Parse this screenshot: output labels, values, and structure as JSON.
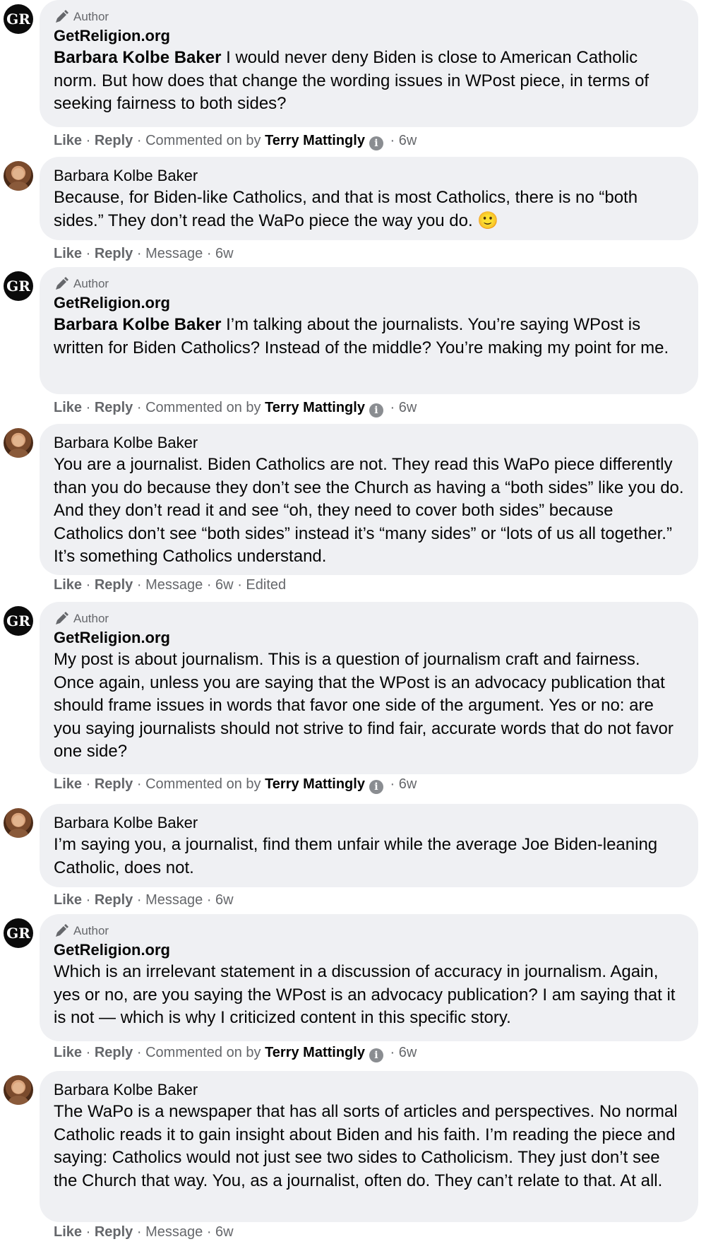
{
  "labels": {
    "author_badge": "Author",
    "like": "Like",
    "reply": "Reply",
    "message": "Message",
    "commented_on_by": "Commented on by",
    "edited": "Edited",
    "sep": "·"
  },
  "page_name": "GetReligion.org",
  "admin_name": "Terry Mattingly",
  "user_name": "Barbara Kolbe Baker",
  "comments": [
    {
      "mention": "Barbara Kolbe Baker",
      "text": " I would never deny Biden is close to American Catholic norm. But how does that change the wording issues in WPost piece, in terms of seeking fairness to both sides?",
      "time": "6w"
    },
    {
      "text": "Because, for Biden-like Catholics, and that is most Catholics, there is no “both sides.” They don’t read the WaPo piece the way you do. 🙂",
      "time": "6w"
    },
    {
      "mention": "Barbara Kolbe Baker",
      "text": " I’m talking about the journalists. You’re saying WPost is written for Biden Catholics? Instead of the middle? You’re making my point for me.",
      "time": "6w"
    },
    {
      "text": "You are a journalist. Biden Catholics are not. They read this WaPo piece differently than you do because they don’t see the Church as having a “both sides” like you do. And they don’t read it and see “oh, they need to cover both sides” because Catholics don’t see “both sides” instead it’s “many sides” or “lots of us all together.” It’s something Catholics understand.",
      "time": "6w"
    },
    {
      "text": "My post is about journalism. This is a question of journalism craft and fairness. Once again, unless you are saying that the WPost is an advocacy publication that should frame issues in words that favor one side of the argument. Yes or no: are you saying journalists should not strive to find fair, accurate words that do not favor one side?",
      "time": "6w"
    },
    {
      "text": "I’m saying you, a journalist, find them unfair while the average Joe Biden-leaning Catholic, does not.",
      "time": "6w"
    },
    {
      "text": "Which is an irrelevant statement in a discussion of accuracy in journalism. Again, yes or no, are you saying the WPost is an advocacy publication? I am saying that it is not — which is why I criticized content in this specific story.",
      "time": "6w"
    },
    {
      "text": "The WaPo is a newspaper that has all sorts of articles and perspectives. No normal Catholic reads it to gain insight about Biden and his faith. I’m reading the piece and saying: Catholics would not just see two sides to Catholicism. They just don’t see the Church that way. You, as a journalist, often do. They can’t relate to that. At all.",
      "time": "6w"
    }
  ]
}
